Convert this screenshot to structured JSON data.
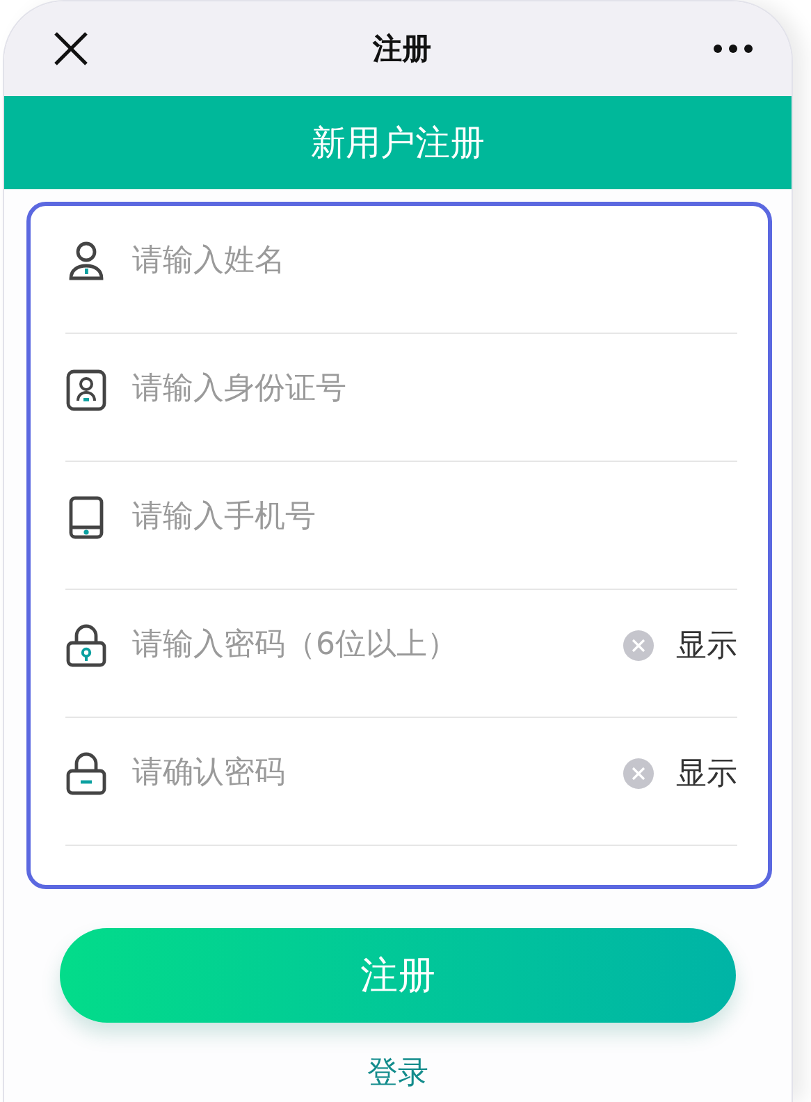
{
  "nav": {
    "title": "注册"
  },
  "header": {
    "title": "新用户注册"
  },
  "fields": [
    {
      "kind": "user",
      "placeholder": "请输入姓名"
    },
    {
      "kind": "idcard",
      "placeholder": "请输入身份证号"
    },
    {
      "kind": "phone",
      "placeholder": "请输入手机号"
    },
    {
      "kind": "lock",
      "placeholder": "请输入密码（6位以上）",
      "toggle": "显示"
    },
    {
      "kind": "lock-confirm",
      "placeholder": "请确认密码",
      "toggle": "显示"
    }
  ],
  "submit": "注册",
  "login_link": "登录"
}
